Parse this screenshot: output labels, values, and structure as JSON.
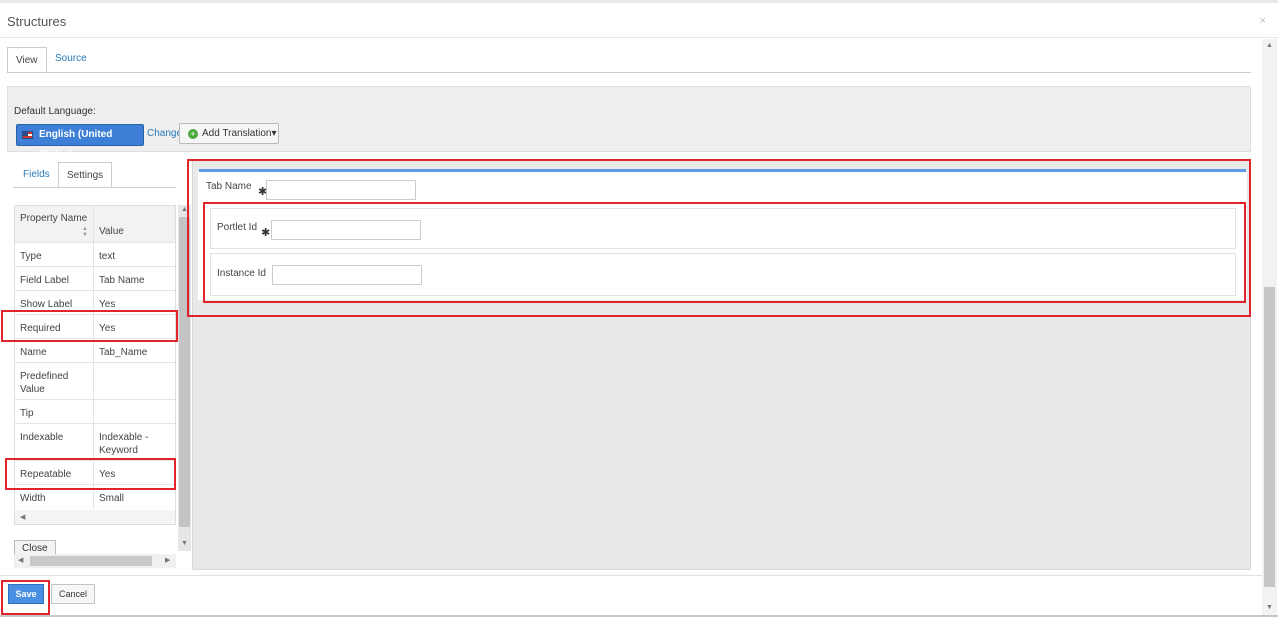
{
  "dialog": {
    "title": "Structures",
    "close": "×"
  },
  "tabs": [
    {
      "label": "View"
    },
    {
      "label": "Source"
    }
  ],
  "language": {
    "label": "Default Language:",
    "selected": "English (United States)",
    "change": "Change",
    "add_translation": "Add Translation▾"
  },
  "left_tabs": [
    {
      "label": "Fields"
    },
    {
      "label": "Settings"
    }
  ],
  "properties": {
    "headers": [
      "Property Name",
      "Value"
    ],
    "rows": [
      {
        "name": "Type",
        "value": "text"
      },
      {
        "name": "Field Label",
        "value": "Tab Name"
      },
      {
        "name": "Show Label",
        "value": "Yes"
      },
      {
        "name": "Required",
        "value": "Yes"
      },
      {
        "name": "Name",
        "value": "Tab_Name"
      },
      {
        "name": "Predefined Value",
        "value": ""
      },
      {
        "name": "Tip",
        "value": ""
      },
      {
        "name": "Indexable",
        "value": "Indexable - Keyword"
      },
      {
        "name": "Repeatable",
        "value": "Yes"
      },
      {
        "name": "Width",
        "value": "Small"
      }
    ],
    "close": "Close"
  },
  "form": {
    "tab_name": {
      "label": "Tab Name",
      "required": "✱",
      "value": ""
    },
    "portlet_id": {
      "label": "Portlet Id",
      "required": "✱",
      "value": ""
    },
    "instance_id": {
      "label": "Instance Id",
      "value": ""
    }
  },
  "footer": {
    "save": "Save",
    "cancel": "Cancel"
  },
  "colors": {
    "accent": "#4a90e2",
    "highlight": "#e0242c"
  }
}
